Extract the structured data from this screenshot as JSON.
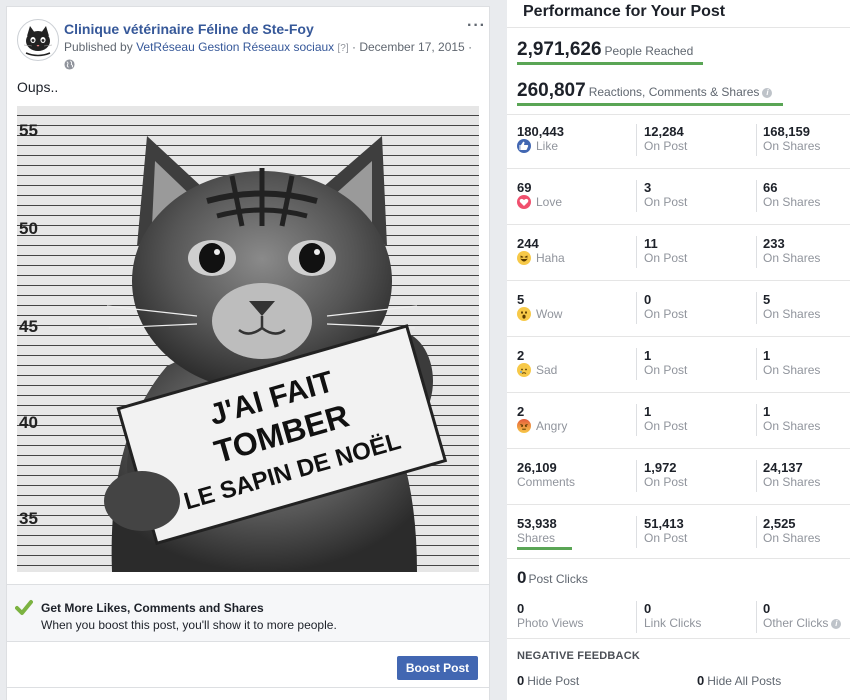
{
  "post": {
    "page_name": "Clinique vétérinaire Féline de Ste-Foy",
    "published_by_prefix": "Published by",
    "published_by_name": "VetRéseau Gestion Réseaux sociaux",
    "published_help": "[?]",
    "date": "· December 17, 2015 ·",
    "more_label": "···",
    "text": "Oups..",
    "photo": {
      "ruler_marks": [
        "55",
        "50",
        "45",
        "40",
        "35"
      ],
      "sign_lines": [
        "J'AI FAIT",
        "TOMBER",
        "LE SAPIN DE NOËL"
      ]
    },
    "boost_title": "Get More Likes, Comments and Shares",
    "boost_desc": "When you boost this post, you'll show it to more people.",
    "boost_button": "Boost Post"
  },
  "performance": {
    "title": "Performance for Your Post",
    "reached": {
      "value": "2,971,626",
      "label": "People Reached"
    },
    "engagement": {
      "value": "260,807",
      "label": "Reactions, Comments & Shares"
    },
    "rows": [
      {
        "total": "180,443",
        "label": "Like",
        "icon": "like-icon",
        "on_post": "12,284",
        "on_shares": "168,159"
      },
      {
        "total": "69",
        "label": "Love",
        "icon": "love-icon",
        "on_post": "3",
        "on_shares": "66"
      },
      {
        "total": "244",
        "label": "Haha",
        "icon": "haha-icon",
        "on_post": "11",
        "on_shares": "233"
      },
      {
        "total": "5",
        "label": "Wow",
        "icon": "wow-icon",
        "on_post": "0",
        "on_shares": "5"
      },
      {
        "total": "2",
        "label": "Sad",
        "icon": "sad-icon",
        "on_post": "1",
        "on_shares": "1"
      },
      {
        "total": "2",
        "label": "Angry",
        "icon": "angry-icon",
        "on_post": "1",
        "on_shares": "1"
      },
      {
        "total": "26,109",
        "label": "Comments",
        "icon": "",
        "on_post": "1,972",
        "on_shares": "24,137"
      },
      {
        "total": "53,938",
        "label": "Shares",
        "icon": "",
        "on_post": "51,413",
        "on_shares": "2,525"
      }
    ],
    "on_post_label": "On Post",
    "on_shares_label": "On Shares",
    "post_clicks": {
      "value": "0",
      "label": "Post Clicks"
    },
    "clicks": [
      {
        "value": "0",
        "label": "Photo Views"
      },
      {
        "value": "0",
        "label": "Link Clicks"
      },
      {
        "value": "0",
        "label": "Other Clicks"
      }
    ],
    "negative_title": "NEGATIVE FEEDBACK",
    "negative": [
      {
        "value": "0",
        "label": "Hide Post"
      },
      {
        "value": "0",
        "label": "Hide All Posts"
      }
    ]
  },
  "colors": {
    "link": "#365899",
    "accent_underline": "#5aa555",
    "button": "#4267b2"
  }
}
